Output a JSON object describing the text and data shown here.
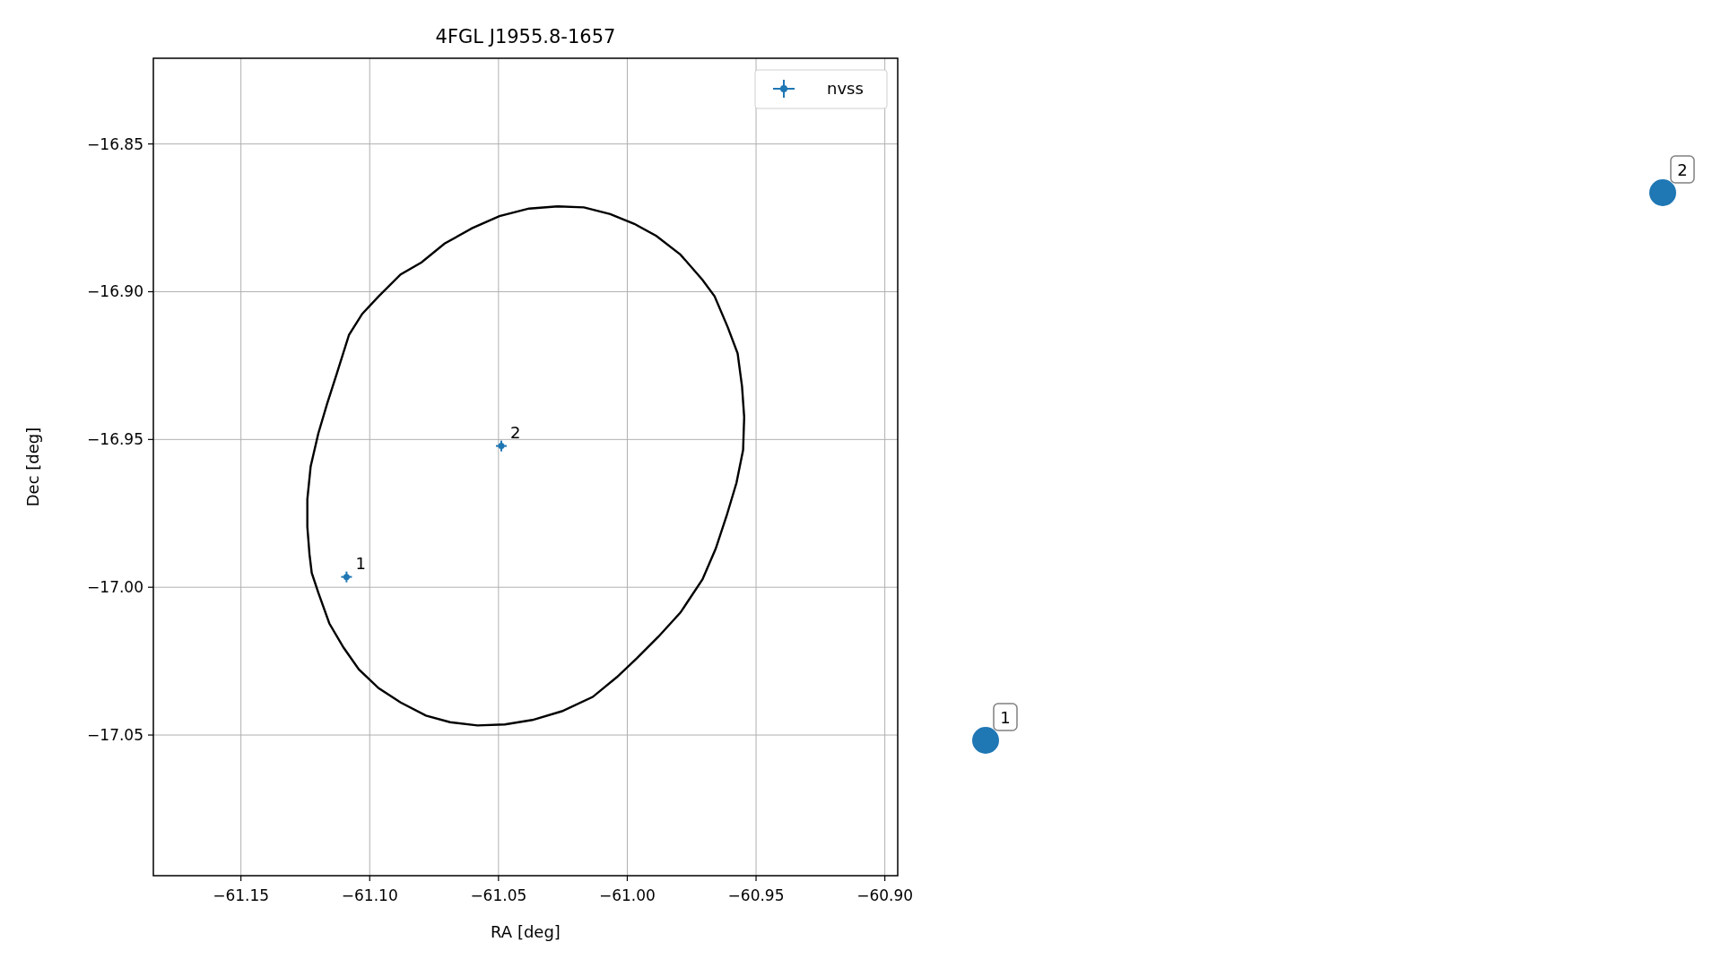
{
  "figure": {
    "chart_data": {
      "type": "scatter",
      "title": "4FGL J1955.8-1657",
      "xlabel": "RA [deg]",
      "ylabel": "Dec [deg]",
      "grid": true,
      "xlim": [
        -61.184,
        -60.895
      ],
      "ylim": [
        -17.0976,
        -16.821
      ],
      "xticks": [
        {
          "value": -61.15,
          "label": "−61.15"
        },
        {
          "value": -61.1,
          "label": "−61.10"
        },
        {
          "value": -61.05,
          "label": "−61.05"
        },
        {
          "value": -61.0,
          "label": "−61.00"
        },
        {
          "value": -60.95,
          "label": "−60.95"
        },
        {
          "value": -60.9,
          "label": "−60.90"
        }
      ],
      "yticks": [
        {
          "value": -16.85,
          "label": "−16.85"
        },
        {
          "value": -16.9,
          "label": "−16.90"
        },
        {
          "value": -16.95,
          "label": "−16.95"
        },
        {
          "value": -17.0,
          "label": "−17.00"
        },
        {
          "value": -17.05,
          "label": "−17.05"
        }
      ],
      "series": [
        {
          "name": "nvss",
          "color": "#1f77b4",
          "x": [
            -61.109,
            -61.0489
          ],
          "values": [
            -16.9965,
            -16.9522
          ]
        }
      ],
      "annotations": [
        "1",
        "2"
      ]
    },
    "outside_markers": [
      {
        "label": "1",
        "color": "#1f77b4"
      },
      {
        "label": "2",
        "color": "#1f77b4"
      }
    ]
  }
}
